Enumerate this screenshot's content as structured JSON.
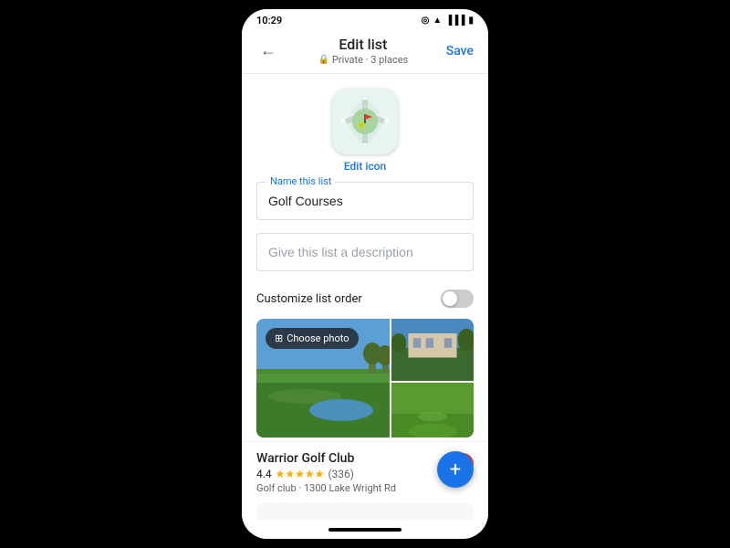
{
  "status_bar": {
    "time": "10:29",
    "icons": [
      "location",
      "wifi",
      "signal",
      "battery"
    ]
  },
  "header": {
    "back_label": "←",
    "title": "Edit list",
    "subtitle": "Private · 3 places",
    "save_label": "Save"
  },
  "icon_section": {
    "edit_icon_label": "Edit icon"
  },
  "form": {
    "name_label": "Name this list",
    "name_value": "Golf Courses",
    "description_placeholder": "Give this list a description",
    "toggle_label": "Customize list order"
  },
  "photo": {
    "choose_photo_label": "Choose photo"
  },
  "place": {
    "name": "Warrior Golf Club",
    "rating": "4.4",
    "stars": "★★★★★",
    "review_count": "(336)",
    "type": "Golf club · 1300 Lake Wright Rd"
  }
}
